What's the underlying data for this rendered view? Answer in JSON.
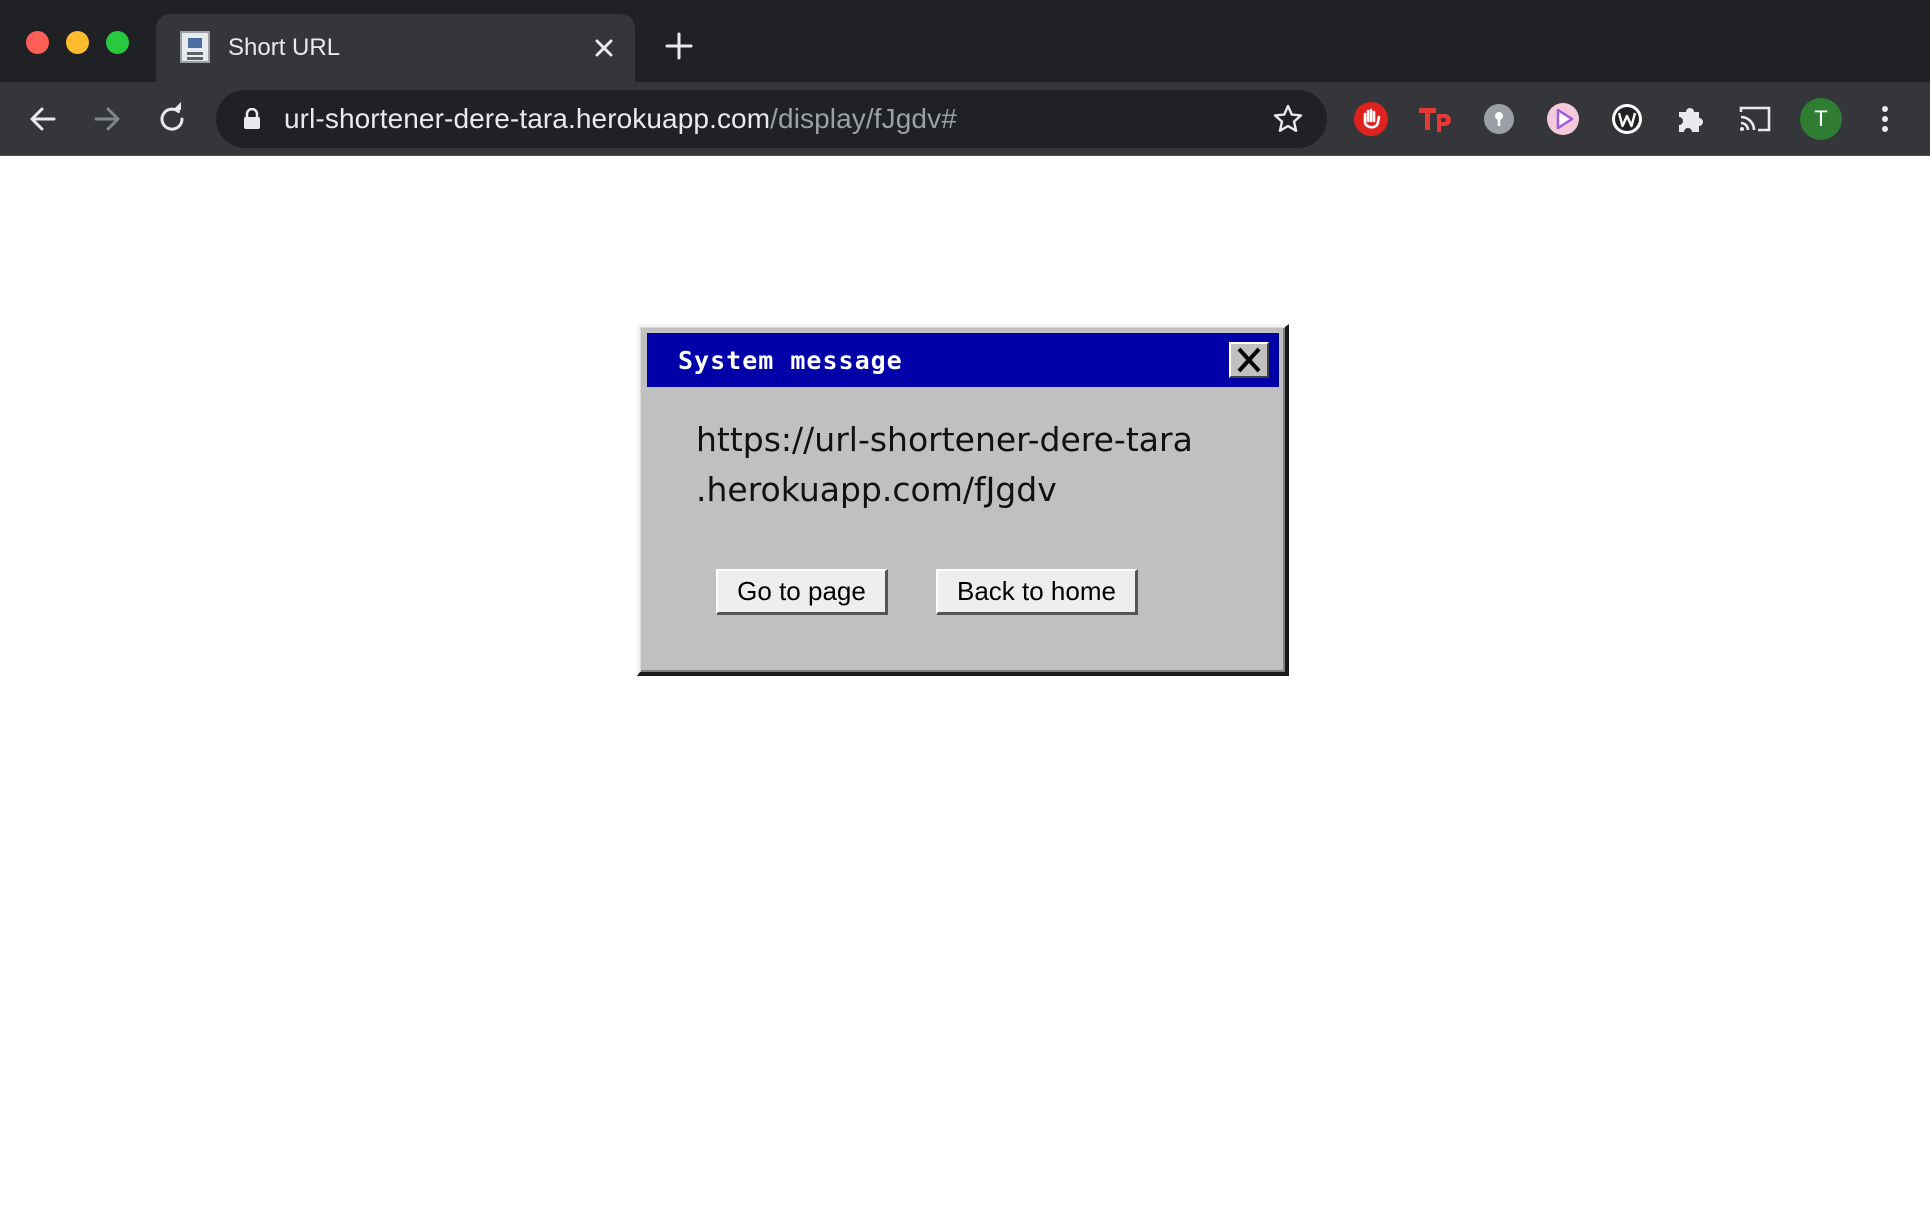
{
  "browser": {
    "tab": {
      "title": "Short URL",
      "favicon": "computer-icon"
    },
    "new_tab_icon": "plus-icon",
    "address": {
      "host": "url-shortener-dere-tara.herokuapp.com",
      "path": "/display/fJgdv#"
    },
    "avatar_letter": "T",
    "extensions": [
      "hand-stop-icon",
      "tp-icon",
      "circle-pin-icon",
      "play-icon",
      "w-icon",
      "puzzle-icon",
      "cast-icon"
    ]
  },
  "dialog": {
    "title": "System message",
    "message_lines": [
      "https://url-shortener-dere-tara",
      ".herokuapp.com/fJgdv"
    ],
    "buttons": {
      "go_to_page": "Go to page",
      "back_to_home": "Back to home"
    }
  },
  "colors": {
    "titlebar": "#0000a8",
    "dialog_bg": "#c0c0c0",
    "chrome_dark": "#202124",
    "chrome_toolbar": "#35363a"
  }
}
